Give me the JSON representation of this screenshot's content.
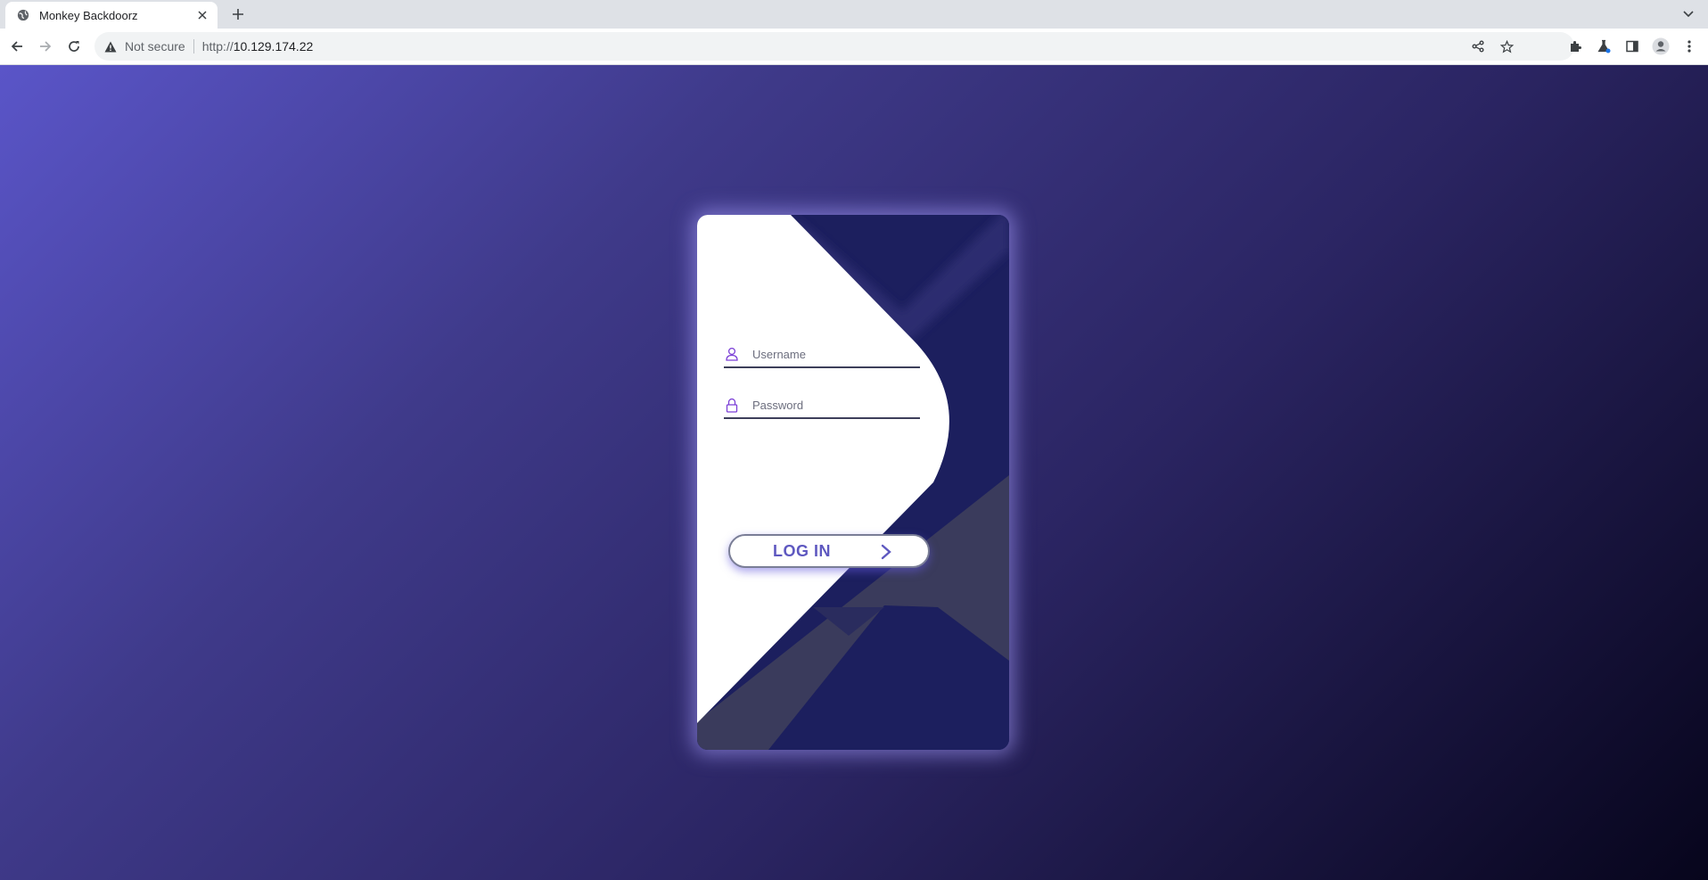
{
  "browser": {
    "tab": {
      "title": "Monkey Backdoorz"
    },
    "address": {
      "security_label": "Not secure",
      "url_scheme": "http://",
      "url_host": "10.129.174.22"
    }
  },
  "login": {
    "username_placeholder": "Username",
    "password_placeholder": "Password",
    "button_label": "LOG IN"
  },
  "colors": {
    "accent": "#5e58c0",
    "card_dark": "#1c1f5e",
    "icon_purple": "#7b3fd6"
  }
}
